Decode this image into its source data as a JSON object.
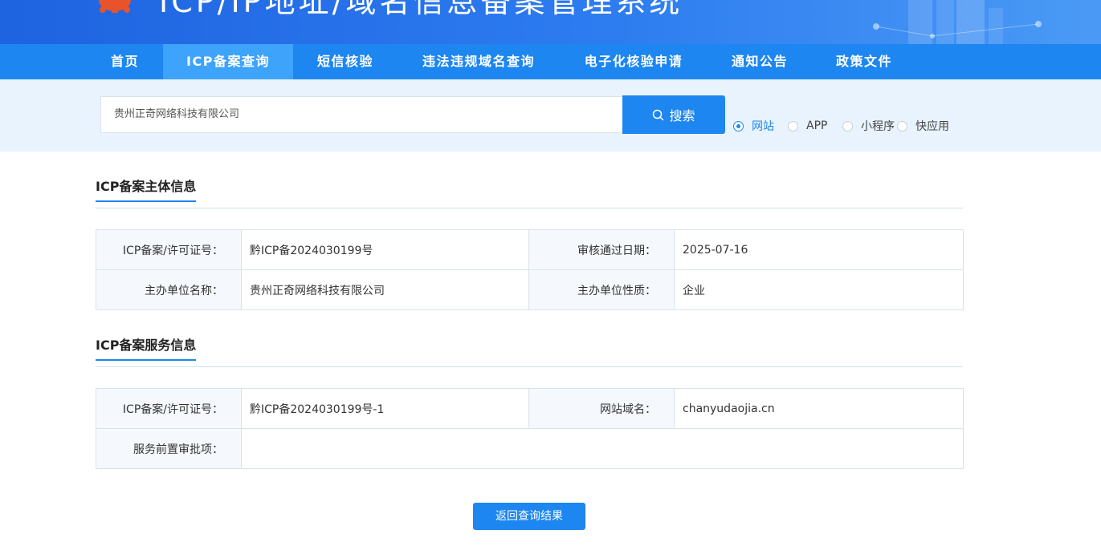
{
  "header": {
    "title": "ICP/IP地址/域名信息备案管理系统"
  },
  "nav": {
    "items": [
      {
        "label": "首页",
        "active": false
      },
      {
        "label": "ICP备案查询",
        "active": true
      },
      {
        "label": "短信核验",
        "active": false
      },
      {
        "label": "违法违规域名查询",
        "active": false
      },
      {
        "label": "电子化核验申请",
        "active": false
      },
      {
        "label": "通知公告",
        "active": false
      },
      {
        "label": "政策文件",
        "active": false
      }
    ]
  },
  "search": {
    "value": "贵州正奇网络科技有限公司",
    "button_label": "搜索",
    "types": [
      {
        "label": "网站",
        "checked": true
      },
      {
        "label": "APP",
        "checked": false
      },
      {
        "label": "小程序",
        "checked": false
      },
      {
        "label": "快应用",
        "checked": false
      }
    ]
  },
  "subject_info": {
    "title": "ICP备案主体信息",
    "rows": [
      {
        "label1": "ICP备案/许可证号：",
        "value1": "黔ICP备2024030199号",
        "label2": "审核通过日期：",
        "value2": "2025-07-16"
      },
      {
        "label1": "主办单位名称：",
        "value1": "贵州正奇网络科技有限公司",
        "label2": "主办单位性质：",
        "value2": "企业"
      }
    ]
  },
  "service_info": {
    "title": "ICP备案服务信息",
    "license_label": "ICP备案/许可证号：",
    "license_value": "黔ICP备2024030199号-1",
    "domain_label": "网站域名：",
    "domain_value": "chanyudaojia.cn",
    "approval_label": "服务前置审批项：",
    "approval_value": ""
  },
  "back_button": "返回查询结果",
  "colors": {
    "primary": "#1d86f0",
    "nav_active": "#3da3fb",
    "search_band": "#e8f3fd"
  }
}
